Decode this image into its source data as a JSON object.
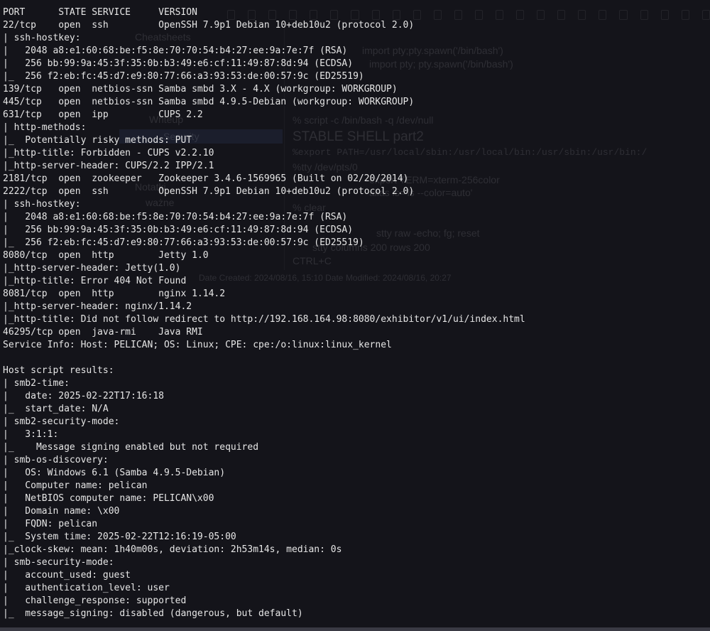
{
  "terminal": {
    "background_color": "#14141a",
    "text_color": "#e6e6e6",
    "lines": [
      "PORT      STATE SERVICE     VERSION",
      "22/tcp    open  ssh         OpenSSH 7.9p1 Debian 10+deb10u2 (protocol 2.0)",
      "| ssh-hostkey: ",
      "|   2048 a8:e1:60:68:be:f5:8e:70:70:54:b4:27:ee:9a:7e:7f (RSA)",
      "|   256 bb:99:9a:45:3f:35:0b:b3:49:e6:cf:11:49:87:8d:94 (ECDSA)",
      "|_  256 f2:eb:fc:45:d7:e9:80:77:66:a3:93:53:de:00:57:9c (ED25519)",
      "139/tcp   open  netbios-ssn Samba smbd 3.X - 4.X (workgroup: WORKGROUP)",
      "445/tcp   open  netbios-ssn Samba smbd 4.9.5-Debian (workgroup: WORKGROUP)",
      "631/tcp   open  ipp         CUPS 2.2",
      "| http-methods: ",
      "|_  Potentially risky methods: PUT",
      "|_http-title: Forbidden - CUPS v2.2.10",
      "|_http-server-header: CUPS/2.2 IPP/2.1",
      "2181/tcp  open  zookeeper   Zookeeper 3.4.6-1569965 (Built on 02/20/2014)",
      "2222/tcp  open  ssh         OpenSSH 7.9p1 Debian 10+deb10u2 (protocol 2.0)",
      "| ssh-hostkey: ",
      "|   2048 a8:e1:60:68:be:f5:8e:70:70:54:b4:27:ee:9a:7e:7f (RSA)",
      "|   256 bb:99:9a:45:3f:35:0b:b3:49:e6:cf:11:49:87:8d:94 (ECDSA)",
      "|_  256 f2:eb:fc:45:d7:e9:80:77:66:a3:93:53:de:00:57:9c (ED25519)",
      "8080/tcp  open  http        Jetty 1.0",
      "|_http-server-header: Jetty(1.0)",
      "|_http-title: Error 404 Not Found",
      "8081/tcp  open  http        nginx 1.14.2",
      "|_http-server-header: nginx/1.14.2",
      "|_http-title: Did not follow redirect to http://192.168.164.98:8080/exhibitor/v1/ui/index.html",
      "46295/tcp open  java-rmi    Java RMI",
      "Service Info: Host: PELICAN; OS: Linux; CPE: cpe:/o:linux:linux_kernel",
      "",
      "Host script results:",
      "| smb2-time: ",
      "|   date: 2025-02-22T17:16:18",
      "|_  start_date: N/A",
      "| smb2-security-mode: ",
      "|   3:1:1: ",
      "|_    Message signing enabled but not required",
      "| smb-os-discovery: ",
      "|   OS: Windows 6.1 (Samba 4.9.5-Debian)",
      "|   Computer name: pelican",
      "|   NetBIOS computer name: PELICAN\\x00",
      "|   Domain name: \\x00",
      "|   FQDN: pelican",
      "|_  System time: 2025-02-22T12:16:19-05:00",
      "|_clock-skew: mean: 1h40m00s, deviation: 2h53m14s, median: 0s",
      "| smb-security-mode: ",
      "|   account_used: guest",
      "|   authentication_level: user",
      "|   challenge_response: supported",
      "|_  message_signing: disabled (dangerous, but default)"
    ]
  },
  "background_window": {
    "sidebar_items": [
      "Cheatsheets",
      "Writeup",
      "Security",
      "Notatki",
      "ważne"
    ],
    "note_lines": [
      "import pty;pty.spawn('/bin/bash')",
      "import pty; pty.spawn('/bin/bash')",
      "% script -c /bin/bash -q /dev/null",
      "STABLE SHELL part2",
      "%export PATH=/usr/local/sbin:/usr/local/bin:/usr/sbin:/usr/bin:/",
      "%tty /dev/pts/0",
      "export TERM=xterm-256color",
      "alias ls='ls --color=auto'",
      "% clear",
      "stty raw -echo; fg; reset",
      "stty columns 200 rows 200",
      "CTRL+C",
      "Date Created: 2024/08/16, 15:10   Date Modified: 2024/08/16, 20:27"
    ]
  }
}
